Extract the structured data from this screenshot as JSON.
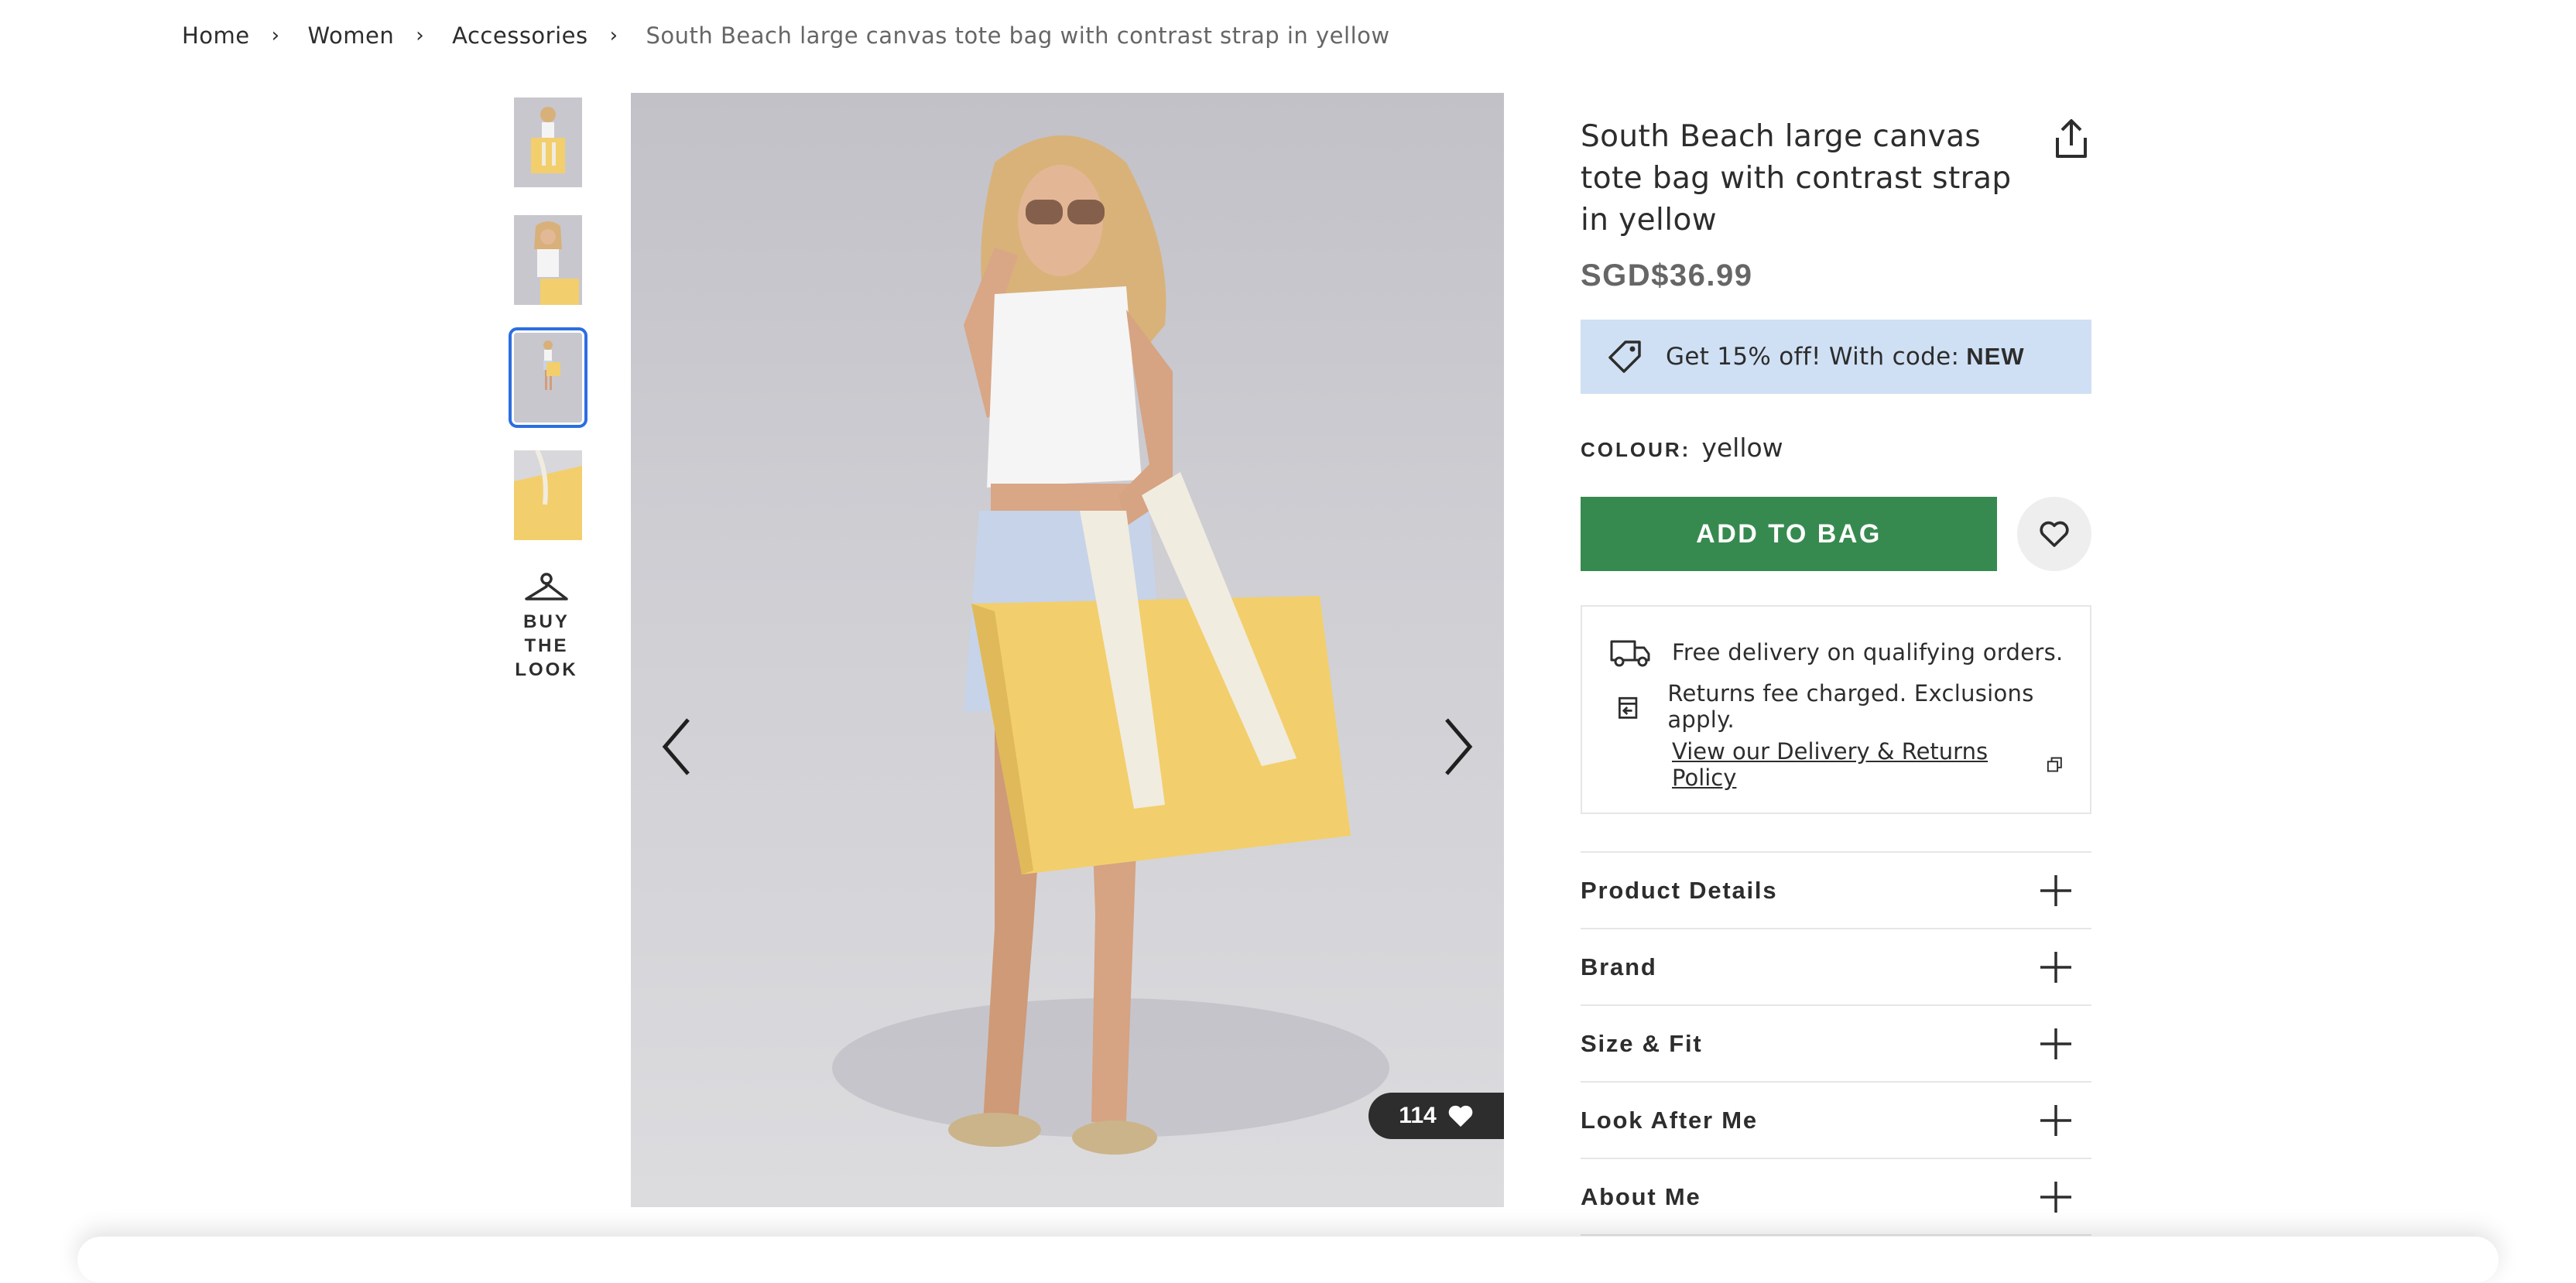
{
  "breadcrumb": {
    "items": [
      "Home",
      "Women",
      "Accessories",
      "South Beach large canvas tote bag with contrast strap in yellow"
    ],
    "separator": "›"
  },
  "gallery": {
    "thumbnail_count": 4,
    "active_index": 2,
    "buy_the_look": "BUY THE LOOK",
    "likes": "114"
  },
  "product": {
    "title": "South Beach large canvas tote bag with contrast strap in yellow",
    "price": "SGD$36.99",
    "promo": {
      "text": "Get 15% off! With code:",
      "code": "NEW"
    },
    "colour_label": "COLOUR:",
    "colour_value": "yellow",
    "add_to_bag": "ADD TO BAG"
  },
  "delivery": {
    "free_delivery": "Free delivery on qualifying orders.",
    "returns": "Returns fee charged. Exclusions apply.",
    "policy_link": "View our Delivery & Returns Policy"
  },
  "accordion": [
    "Product Details",
    "Brand",
    "Size & Fit",
    "Look After Me",
    "About Me"
  ],
  "colors": {
    "add_to_bag": "#378a4f",
    "promo_bg": "#d0e0f4",
    "active_thumb": "#2c6ee0",
    "bag_yellow": "#f2cf6c"
  },
  "icons": [
    "share-icon",
    "tag-icon",
    "heart-icon",
    "truck-icon",
    "returns-icon",
    "external-link-icon",
    "plus-icon",
    "hanger-icon",
    "chevron-left-icon",
    "chevron-right-icon"
  ]
}
